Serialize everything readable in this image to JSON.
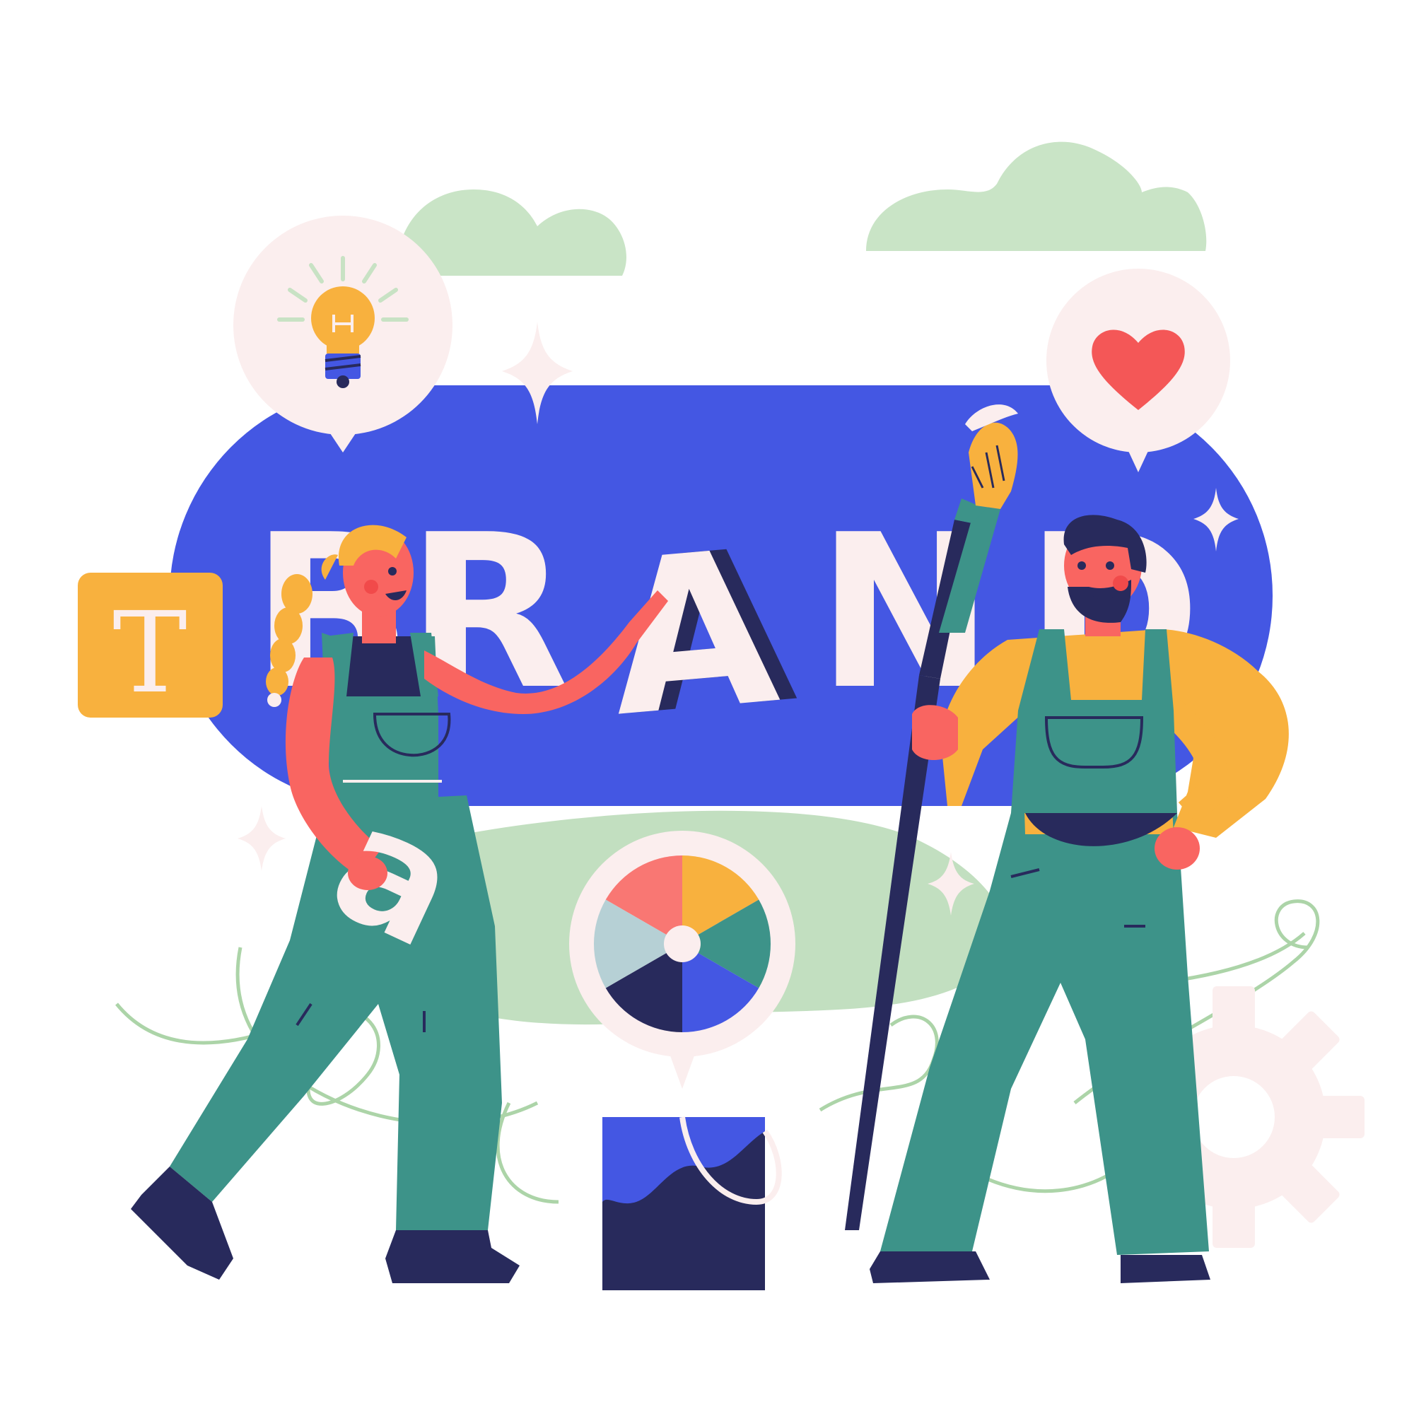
{
  "illustration": {
    "headline_letters": [
      "B",
      "R",
      "A",
      "N",
      "D"
    ],
    "type_icon_letter": "T",
    "held_letter": "a"
  },
  "colors": {
    "brand_blue": "#4457e3",
    "navy": "#282a5c",
    "cream": "#fbeeee",
    "orange": "#f8b13e",
    "coral": "#f96561",
    "green": "#3d9389",
    "light_green": "#c2dfc0",
    "wheel": [
      "#f97773",
      "#f8b13e",
      "#3d9389",
      "#4457e3",
      "#282a5c",
      "#b6d0d5"
    ]
  },
  "icons": [
    "lightbulb-icon",
    "heart-icon",
    "sparkle-icon",
    "gear-icon",
    "color-wheel-icon",
    "text-type-icon"
  ]
}
